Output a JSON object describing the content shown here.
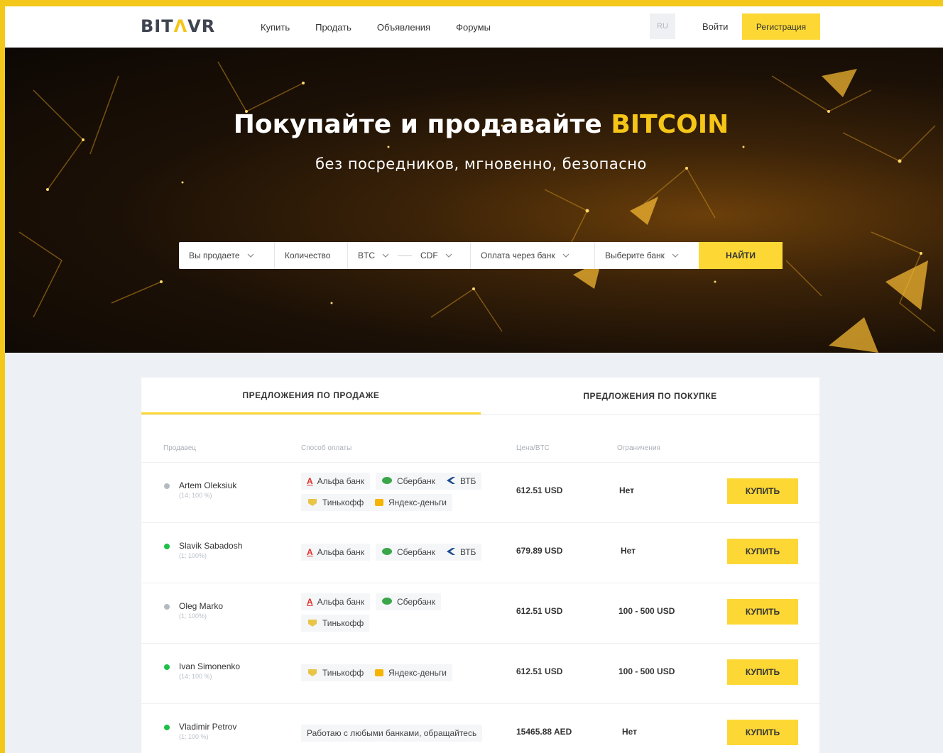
{
  "header": {
    "logo_prefix": "BIT",
    "logo_accent": "Λ",
    "logo_suffix": "VR",
    "nav": [
      "Купить",
      "Продать",
      "Объявления",
      "Форумы"
    ],
    "lang": "RU",
    "login": "Войти",
    "register": "Регистрация"
  },
  "hero": {
    "title": "Покупайте и продавайте",
    "title_highlight": "BITCOIN",
    "subtitle": "без посредников, мгновенно, безопасно"
  },
  "search": {
    "action": "Вы продаете",
    "amount_placeholder": "Количество",
    "crypto": "BTC",
    "fiat": "CDF",
    "payment": "Оплата через банк",
    "bank": "Выберите банк",
    "find_button": "НАЙТИ"
  },
  "offers": {
    "tab_sell": "ПРЕДЛОЖЕНИЯ ПО ПРОДАЖЕ",
    "tab_buy": "ПРЕДЛОЖЕНИЯ ПО ПОКУПКЕ",
    "columns": {
      "seller": "Продавец",
      "payment": "Способ оплаты",
      "price": "Цена/BTC",
      "limits": "Ограничения"
    },
    "buy_label": "КУПИТЬ",
    "rows": [
      {
        "name": "Artem Oleksiuk",
        "stats": "(14; 100 %)",
        "online": false,
        "price": "612.51 USD",
        "limit": "Нет"
      },
      {
        "name": "Slavik Sabadosh",
        "stats": "(1; 100%)",
        "online": true,
        "price": "679.89 USD",
        "limit": "Нет"
      },
      {
        "name": "Oleg Marko",
        "stats": "(1; 100%)",
        "online": false,
        "price": "612.51 USD",
        "limit": "100 - 500 USD"
      },
      {
        "name": "Ivan Simonenko",
        "stats": "(14; 100 %)",
        "online": true,
        "price": "612.51 USD",
        "limit": "100 - 500 USD"
      },
      {
        "name": "Vladimir Petrov",
        "stats": "(1; 100 %)",
        "online": true,
        "price": "15465.88 AED",
        "limit": "Нет"
      }
    ],
    "banks": {
      "alfa": "Альфа банк",
      "sber": "Сбербанк",
      "vtb": "ВТБ",
      "tinkoff": "Тинькофф",
      "yandex": "Яндекс-деньги",
      "any": "Работаю с любыми банками, обращайтесь"
    }
  },
  "colors": {
    "accent": "#fdd835",
    "online": "#1fbf4a",
    "offline": "#b5bac1"
  }
}
